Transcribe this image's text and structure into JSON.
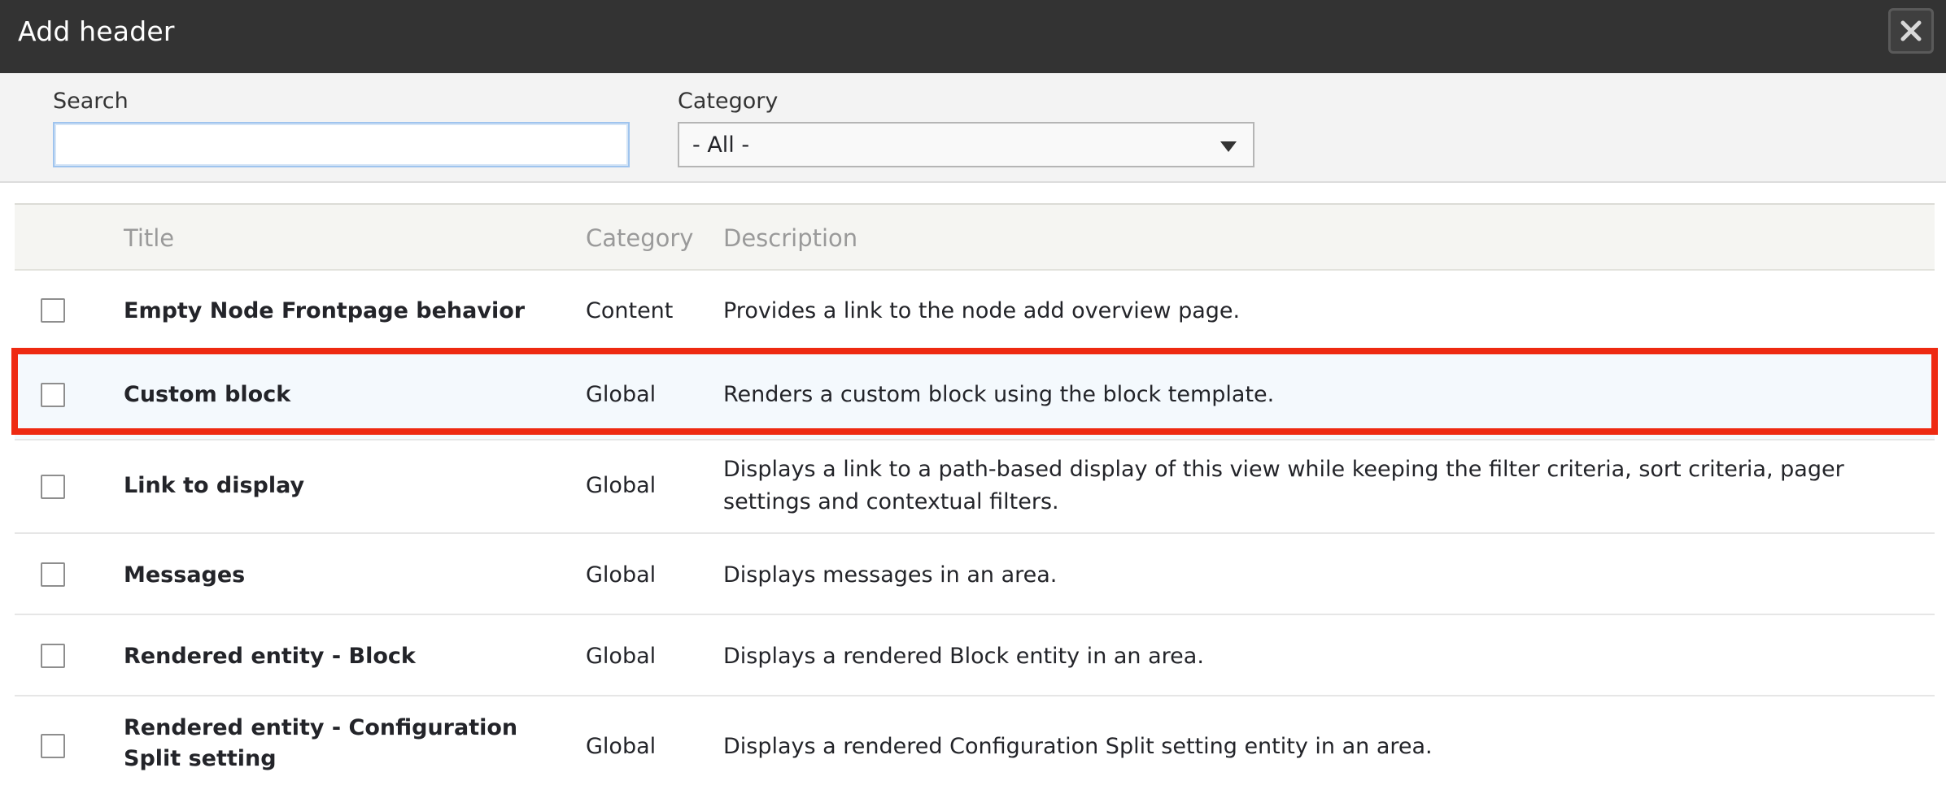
{
  "dialog": {
    "title": "Add header",
    "close_icon": "close-icon"
  },
  "filters": {
    "search_label": "Search",
    "search_value": "",
    "category_label": "Category",
    "category_value": "- All -"
  },
  "table": {
    "headers": {
      "title": "Title",
      "category": "Category",
      "description": "Description"
    },
    "rows": [
      {
        "title": "Empty Node Frontpage behavior",
        "category": "Content",
        "description": "Provides a link to the node add overview page.",
        "checked": false
      },
      {
        "title": "Custom block",
        "category": "Global",
        "description": "Renders a custom block using the block template.",
        "checked": false,
        "highlighted": true
      },
      {
        "title": "Link to display",
        "category": "Global",
        "description": "Displays a link to a path-based display of this view while keeping the filter criteria, sort criteria, pager settings and contextual filters.",
        "checked": false
      },
      {
        "title": "Messages",
        "category": "Global",
        "description": "Displays messages in an area.",
        "checked": false
      },
      {
        "title": "Rendered entity - Block",
        "category": "Global",
        "description": "Displays a rendered Block entity in an area.",
        "checked": false
      },
      {
        "title": "Rendered entity - Configuration Split setting",
        "category": "Global",
        "description": "Displays a rendered Configuration Split setting entity in an area.",
        "checked": false
      }
    ]
  },
  "colors": {
    "titlebar": "#333333",
    "highlight_border": "#ee2a12",
    "highlight_row": "#f4f9fd"
  }
}
